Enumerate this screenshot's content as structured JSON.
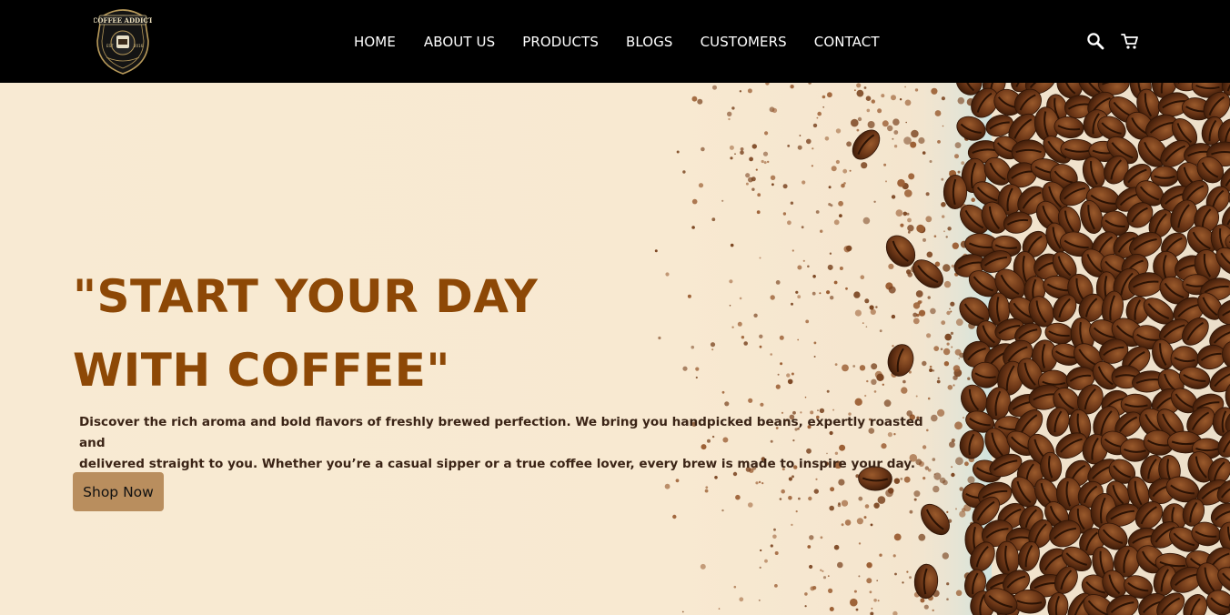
{
  "brand": {
    "logo_text": "COFFEE ADDICT",
    "logo_subtext": "EST 2016"
  },
  "nav": {
    "items": [
      {
        "label": "HOME"
      },
      {
        "label": "ABOUT US"
      },
      {
        "label": "PRODUCTS"
      },
      {
        "label": "BLOGS"
      },
      {
        "label": "CUSTOMERS"
      },
      {
        "label": "CONTACT"
      }
    ],
    "icons": [
      "search-icon",
      "cart-icon"
    ]
  },
  "hero": {
    "headline_line1": "\"START YOUR DAY",
    "headline_line2": "WITH COFFEE\"",
    "description_line1": "Discover the rich aroma and bold flavors of freshly brewed perfection. We bring you handpicked beans, expertly roasted and",
    "description_line2": "delivered straight to you. Whether you’re a casual sipper or a true coffee lover, every brew is made to inspire your day.",
    "cta_label": "Shop Now"
  },
  "colors": {
    "nav_bg": "#000000",
    "hero_bg": "#f8ead3",
    "headline": "#8d4806",
    "cta_bg": "#b98e5e",
    "bean": "#5a2d12"
  }
}
